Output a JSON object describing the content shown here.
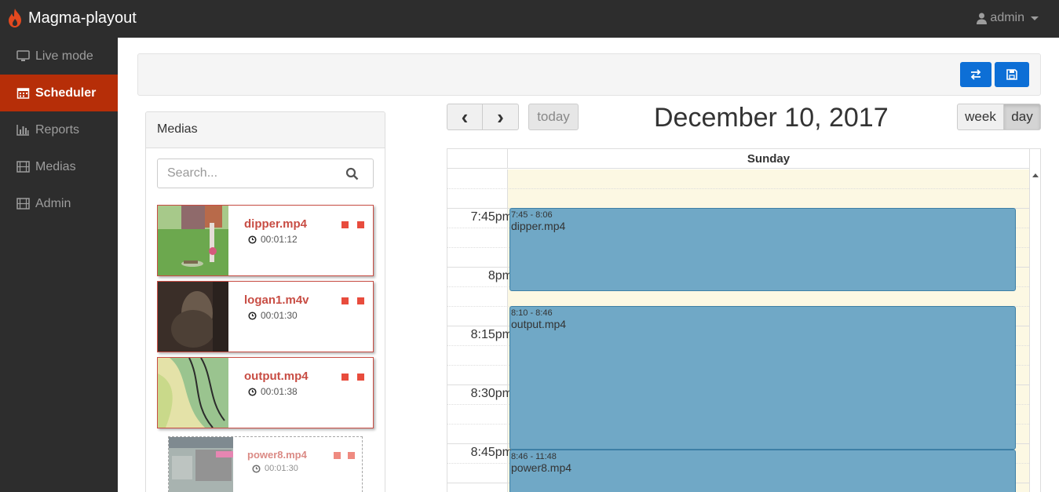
{
  "app": {
    "title": "Magma-playout"
  },
  "user": {
    "name": "admin"
  },
  "sidebar": {
    "items": [
      {
        "label": "Live mode",
        "icon": "monitor-icon"
      },
      {
        "label": "Scheduler",
        "icon": "calendar-icon",
        "active": true
      },
      {
        "label": "Reports",
        "icon": "bar-chart-icon"
      },
      {
        "label": "Medias",
        "icon": "film-icon"
      },
      {
        "label": "Admin",
        "icon": "film-icon"
      }
    ]
  },
  "toolbar": {
    "swap_icon": "swap-icon",
    "save_icon": "save-icon"
  },
  "medias": {
    "title": "Medias",
    "search_placeholder": "Search...",
    "items": [
      {
        "name": "dipper.mp4",
        "duration": "00:01:12"
      },
      {
        "name": "logan1.m4v",
        "duration": "00:01:30"
      },
      {
        "name": "output.mp4",
        "duration": "00:01:38"
      },
      {
        "name": "power8.mp4",
        "duration": "00:01:30",
        "dragging": true
      }
    ]
  },
  "calendar": {
    "prev": "‹",
    "next": "›",
    "today": "today",
    "title": "December 10, 2017",
    "views": {
      "week": "week",
      "day": "day",
      "active": "day"
    },
    "day_header": "Sunday",
    "time_labels": [
      "7:45pm",
      "8pm",
      "8:15pm",
      "8:30pm",
      "8:45pm"
    ],
    "events": [
      {
        "time": "7:45 - 8:06",
        "title": "dipper.mp4"
      },
      {
        "time": "8:10 - 8:46",
        "title": "output.mp4"
      },
      {
        "time": "8:46 - 11:48",
        "title": "power8.mp4"
      }
    ]
  },
  "colors": {
    "navbar": "#2d2d2d",
    "active": "#b62e08",
    "primary": "#0d6fd6",
    "event": "#70a8c6",
    "media_accent": "#c84d44"
  }
}
